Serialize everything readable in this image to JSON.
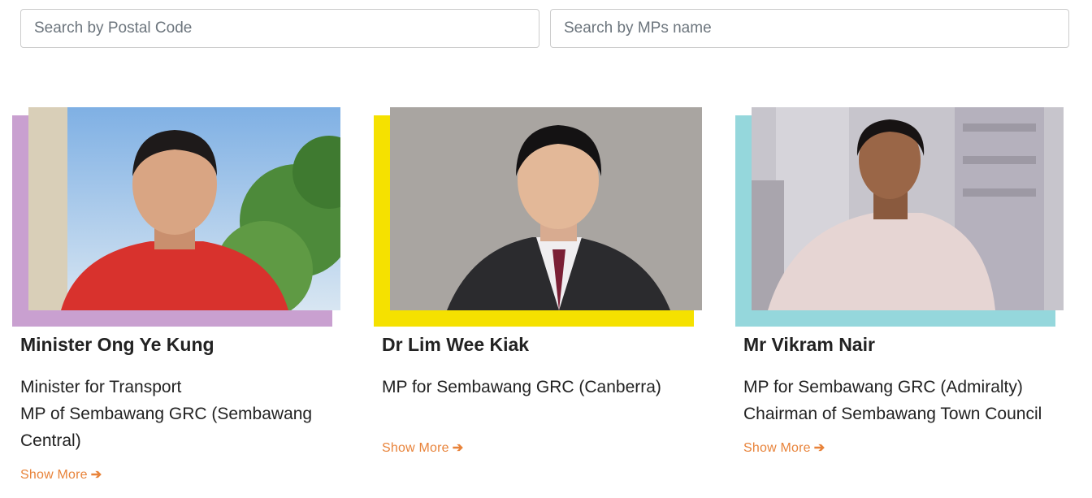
{
  "search": {
    "postal_placeholder": "Search by Postal Code",
    "mp_placeholder": "Search by MPs name"
  },
  "mps": [
    {
      "name": "Minister Ong Ye Kung",
      "roles": [
        "Minister for Transport",
        "MP of Sembawang GRC (Sembawang Central)"
      ],
      "show_more": "Show More",
      "accent_color": "#c9a0d0"
    },
    {
      "name": "Dr Lim Wee Kiak",
      "roles": [
        "MP for Sembawang GRC (Canberra)"
      ],
      "show_more": "Show More",
      "accent_color": "#f5e100"
    },
    {
      "name": "Mr Vikram Nair",
      "roles": [
        "MP for Sembawang GRC (Admiralty)",
        "Chairman of Sembawang Town Council"
      ],
      "show_more": "Show More",
      "accent_color": "#95d7dc"
    }
  ],
  "colors": {
    "link": "#e8833a",
    "text": "#222222"
  }
}
